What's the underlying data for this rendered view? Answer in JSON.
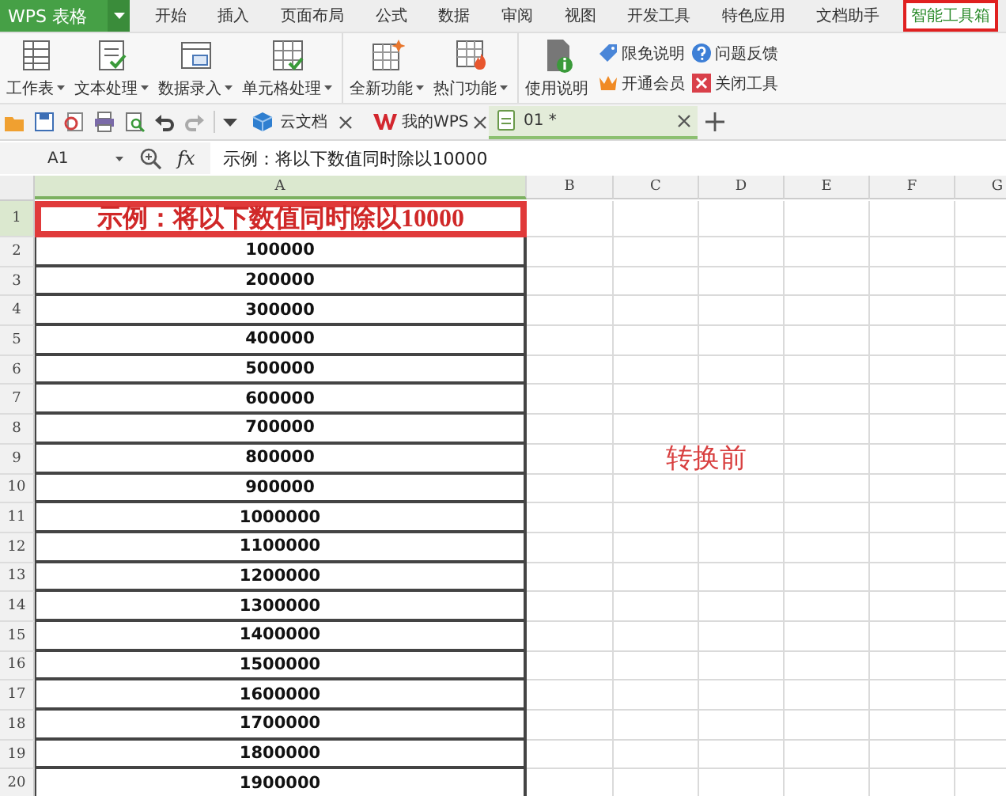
{
  "menu": {
    "app_button": "WPS 表格",
    "tabs": [
      {
        "label": "开始",
        "selected": false
      },
      {
        "label": "插入",
        "selected": false
      },
      {
        "label": "页面布局",
        "selected": false
      },
      {
        "label": "公式",
        "selected": false
      },
      {
        "label": "数据",
        "selected": false
      },
      {
        "label": "审阅",
        "selected": false
      },
      {
        "label": "视图",
        "selected": false
      },
      {
        "label": "开发工具",
        "selected": false
      },
      {
        "label": "特色应用",
        "selected": false
      },
      {
        "label": "文档助手",
        "selected": false
      },
      {
        "label": "智能工具箱",
        "selected": true
      }
    ]
  },
  "ribbon": {
    "groups": [
      [
        {
          "label": "工作表",
          "kind": "sheet",
          "dropdown": true
        },
        {
          "label": "文本处理",
          "kind": "text",
          "dropdown": true
        },
        {
          "label": "数据录入",
          "kind": "entry",
          "dropdown": true
        },
        {
          "label": "单元格处理",
          "kind": "cell",
          "dropdown": true
        }
      ],
      [
        {
          "label": "全新功能",
          "kind": "new",
          "dropdown": true
        },
        {
          "label": "热门功能",
          "kind": "hot",
          "dropdown": true
        }
      ],
      [
        {
          "label": "使用说明",
          "kind": "help",
          "dropdown": false
        }
      ]
    ],
    "small_buttons": [
      {
        "label": "限免说明",
        "kind": "tag"
      },
      {
        "label": "问题反馈",
        "kind": "question"
      },
      {
        "label": "开通会员",
        "kind": "crown"
      },
      {
        "label": "关闭工具",
        "kind": "close"
      }
    ]
  },
  "doc_tabs": [
    {
      "label": "云文档",
      "kind": "cloud",
      "selected": false
    },
    {
      "label": "我的WPS",
      "kind": "wps",
      "selected": false
    },
    {
      "label": "01 *",
      "kind": "sheet",
      "selected": true
    }
  ],
  "formula_bar": {
    "name_box": "A1",
    "fx": "fx",
    "formula": "示例：将以下数值同时除以10000"
  },
  "sheet": {
    "columns": [
      {
        "label": "A",
        "selected": true
      },
      {
        "label": "B",
        "selected": false
      },
      {
        "label": "C",
        "selected": false
      },
      {
        "label": "D",
        "selected": false
      },
      {
        "label": "E",
        "selected": false
      },
      {
        "label": "F",
        "selected": false
      },
      {
        "label": "G",
        "selected": false
      }
    ],
    "rows": [
      {
        "number": "1",
        "selected": true,
        "kind": "title",
        "cell": "示例：将以下数值同时除以10000"
      },
      {
        "number": "2",
        "selected": false,
        "kind": "value",
        "cell": "100000"
      },
      {
        "number": "3",
        "selected": false,
        "kind": "value",
        "cell": "200000"
      },
      {
        "number": "4",
        "selected": false,
        "kind": "value",
        "cell": "300000"
      },
      {
        "number": "5",
        "selected": false,
        "kind": "value",
        "cell": "400000"
      },
      {
        "number": "6",
        "selected": false,
        "kind": "value",
        "cell": "500000"
      },
      {
        "number": "7",
        "selected": false,
        "kind": "value",
        "cell": "600000"
      },
      {
        "number": "8",
        "selected": false,
        "kind": "value",
        "cell": "700000"
      },
      {
        "number": "9",
        "selected": false,
        "kind": "value",
        "cell": "800000"
      },
      {
        "number": "10",
        "selected": false,
        "kind": "value",
        "cell": "900000"
      },
      {
        "number": "11",
        "selected": false,
        "kind": "value",
        "cell": "1000000"
      },
      {
        "number": "12",
        "selected": false,
        "kind": "value",
        "cell": "1100000"
      },
      {
        "number": "13",
        "selected": false,
        "kind": "value",
        "cell": "1200000"
      },
      {
        "number": "14",
        "selected": false,
        "kind": "value",
        "cell": "1300000"
      },
      {
        "number": "15",
        "selected": false,
        "kind": "value",
        "cell": "1400000"
      },
      {
        "number": "16",
        "selected": false,
        "kind": "value",
        "cell": "1500000"
      },
      {
        "number": "17",
        "selected": false,
        "kind": "value",
        "cell": "1600000"
      },
      {
        "number": "18",
        "selected": false,
        "kind": "value",
        "cell": "1700000"
      },
      {
        "number": "19",
        "selected": false,
        "kind": "value",
        "cell": "1800000"
      },
      {
        "number": "20",
        "selected": false,
        "kind": "value",
        "cell": "1900000"
      }
    ],
    "note": "转换前"
  }
}
